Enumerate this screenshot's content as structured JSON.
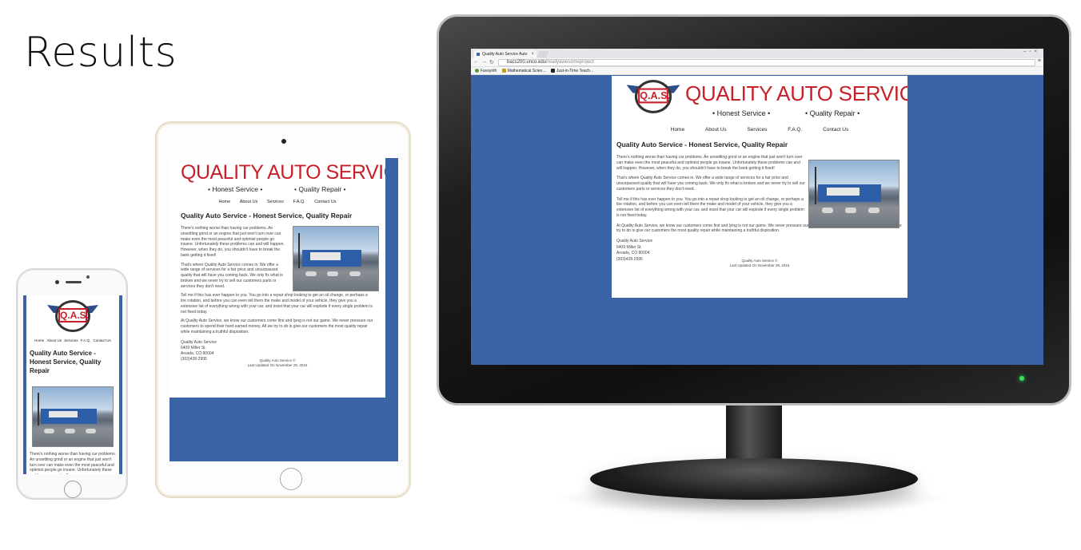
{
  "slide": {
    "title": "Results"
  },
  "site": {
    "brand": "QUALITY AUTO SERVICE",
    "logo_text": "Q.A.S.",
    "tagline_left": "• Honest Service •",
    "tagline_right": "• Quality Repair •",
    "nav": [
      "Home",
      "About Us",
      "Services",
      "F.A.Q.",
      "Contact Us"
    ],
    "heading": "Quality Auto Service - Honest Service, Quality Repair",
    "p1": "There's nothing worse than having car problems. An unsettling grind or an engine that just won't turn over can make even the most peaceful and optimist people go insane. Unfortunately these problems can and will happen. However, when they do, you shouldn't have to break the bank getting it fixed!",
    "p2": "That's where Quality Auto Service comes in. We offer a wide range of services for a fair price and unsurpassed quality that will have you coming back. We only fix what is broken and we never try to sell our customers parts or services they don't need.",
    "p3": "Tell me if this has ever happen to you. You go into a repair shop looking to get an oil change, or perhaps a tire rotation, and before you can even tell them the make and model of your vehicle, they give you a extensive list of everything wrong with your car, and insist that your car will explode if every single problem is not fixed today.",
    "p4": "At Quality Auto Service, we know our customers come first and lying is not our game. We never pressure our customers to spend their hard earned money. All we try to do is give our customers the most quality repair while maintaining a truthful disposition.",
    "address": [
      "Quality Auto Service",
      "6409 Miller St.",
      "Arvada, CO 80004",
      "(303)428-2995"
    ],
    "footer_copy": "Quality Auto Service ©",
    "footer_updated": "Last Updated On November 29, 2015",
    "phone_para": "There's nothing worse than having car problems. An unsettling grind or an engine that just won't turn over can make even the most peaceful and optimist people go insane. Unfortunately these problems can and will"
  },
  "browser": {
    "tab_title": "Quality Auto Service Auto",
    "url_host": "bacs200.unco.edu",
    "url_path": "/reallyawesomeproject",
    "bookmarks": [
      "Favsynth",
      "Mathematical Scien...",
      "Just-in-Time Teach..."
    ]
  },
  "colors": {
    "page_bg": "#3a64a6",
    "brand_red": "#c8202a",
    "led": "#39e05a"
  }
}
